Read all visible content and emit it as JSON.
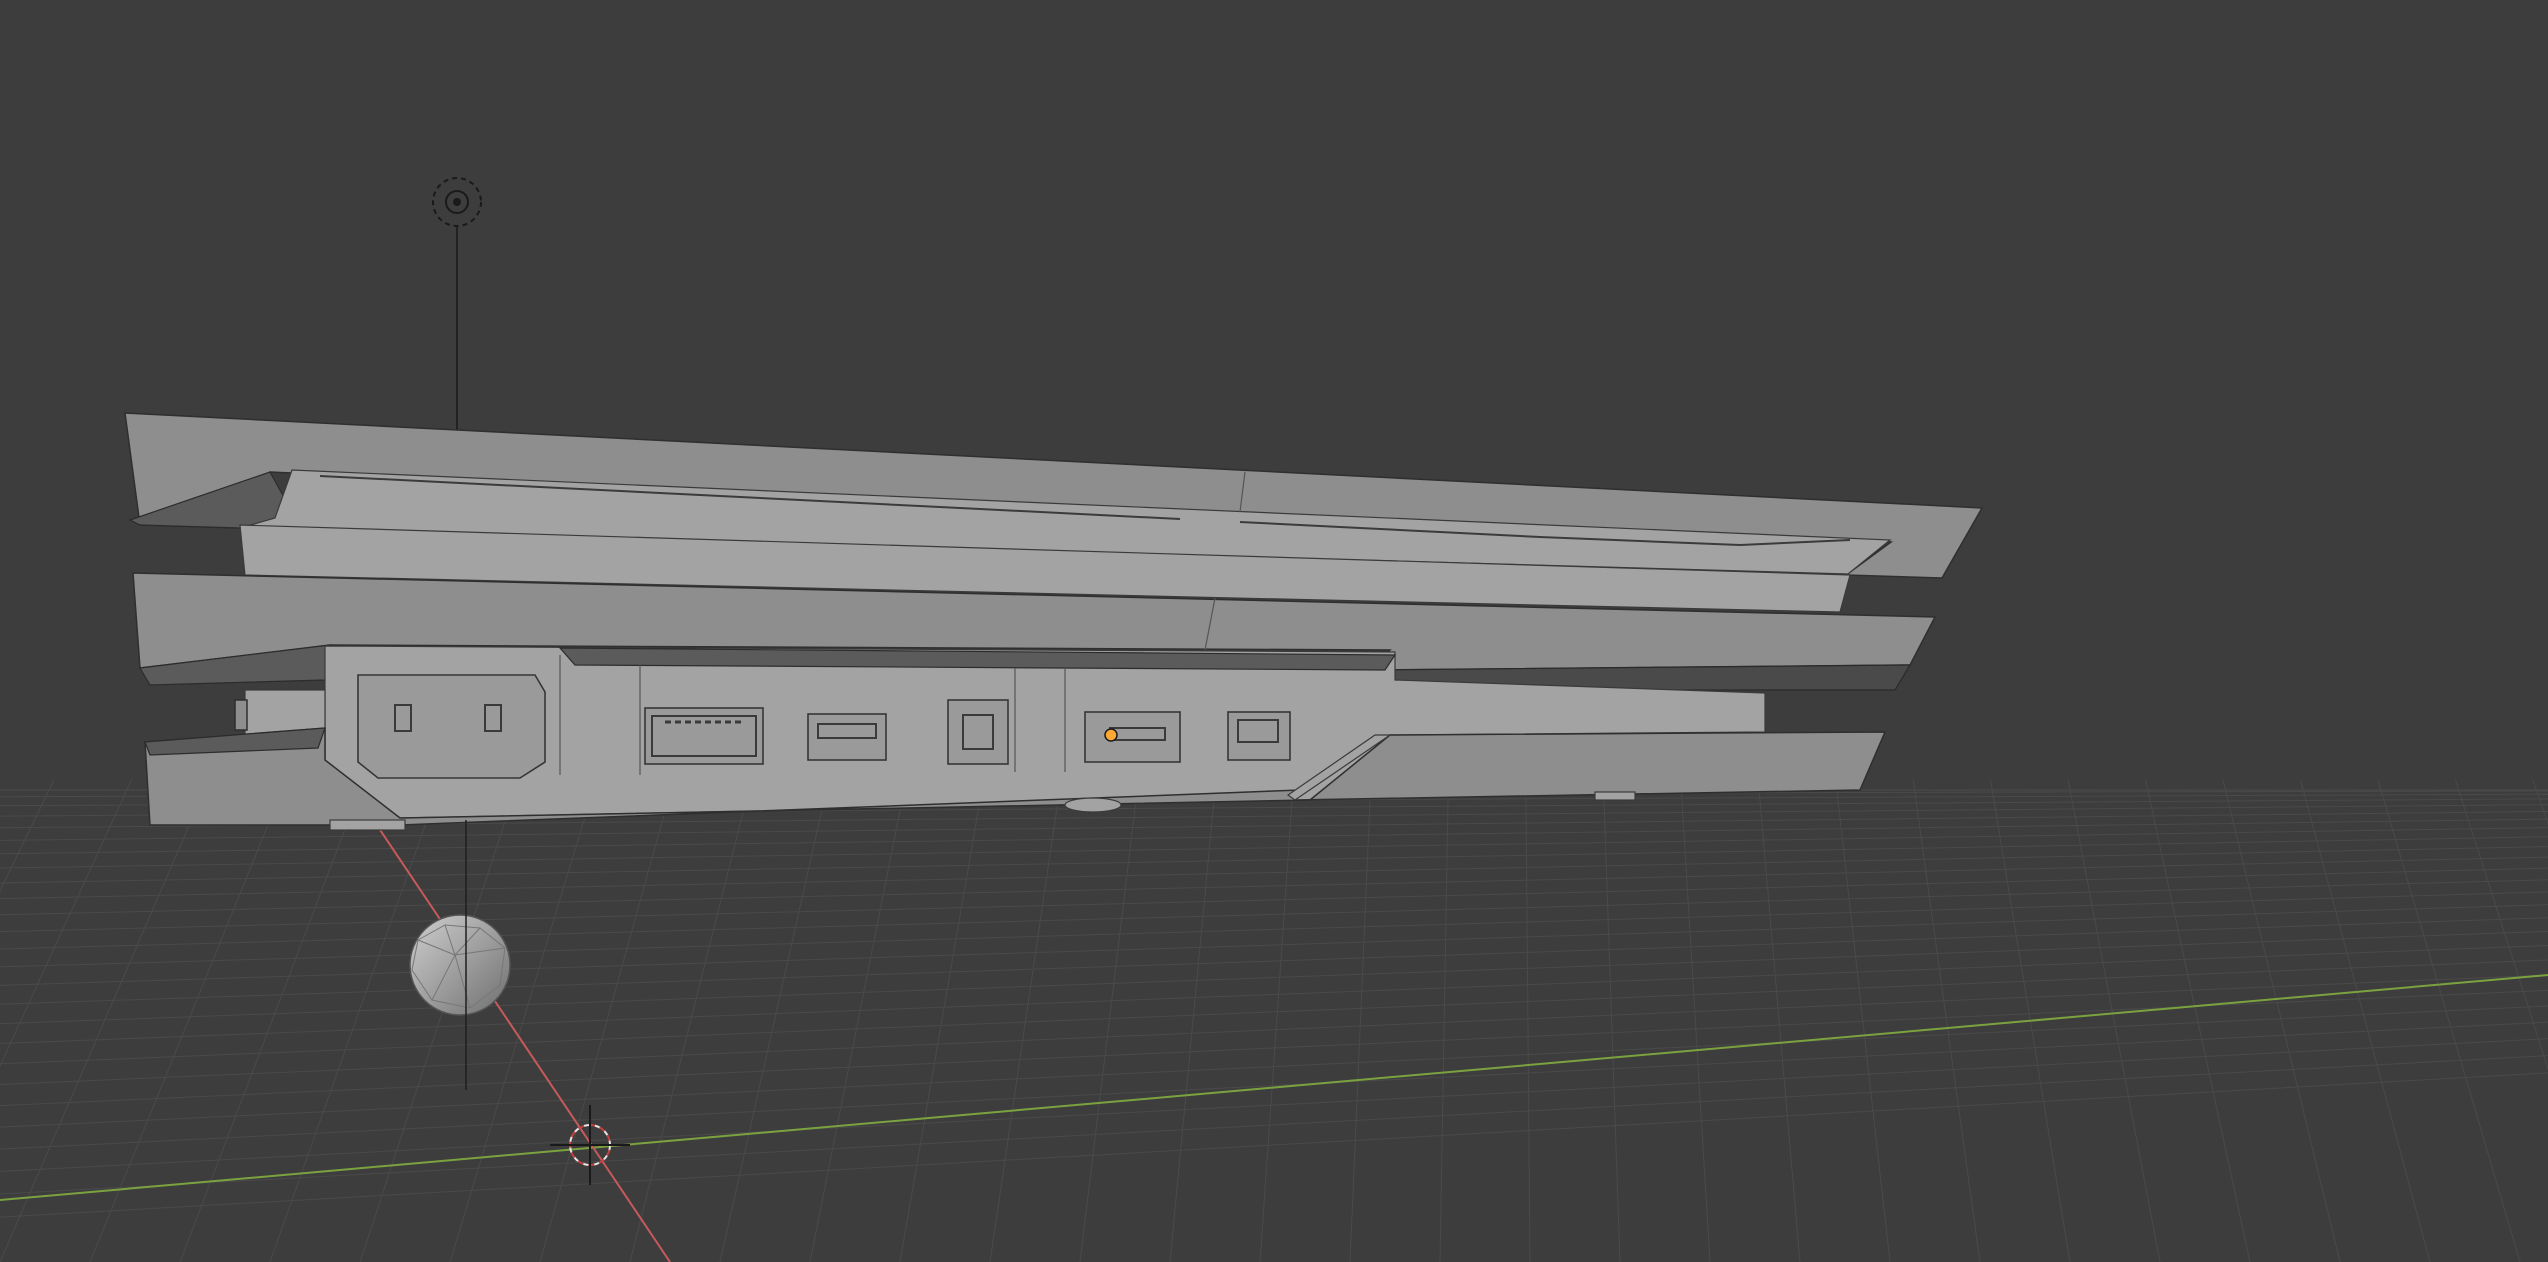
{
  "viewport": {
    "mode": "3d-viewport-solid",
    "background_color": "#3d3d3d",
    "grid_color": "#4a4a4a",
    "axis_x_color": "#c65a5a",
    "axis_y_color": "#7ba23f",
    "selection_color": "#ffa833"
  },
  "scene_objects": {
    "light": "light-object",
    "console_model": "console-mesh",
    "sphere": "ico-sphere-mesh",
    "cursor": "3d-cursor",
    "origin": "object-origin"
  }
}
